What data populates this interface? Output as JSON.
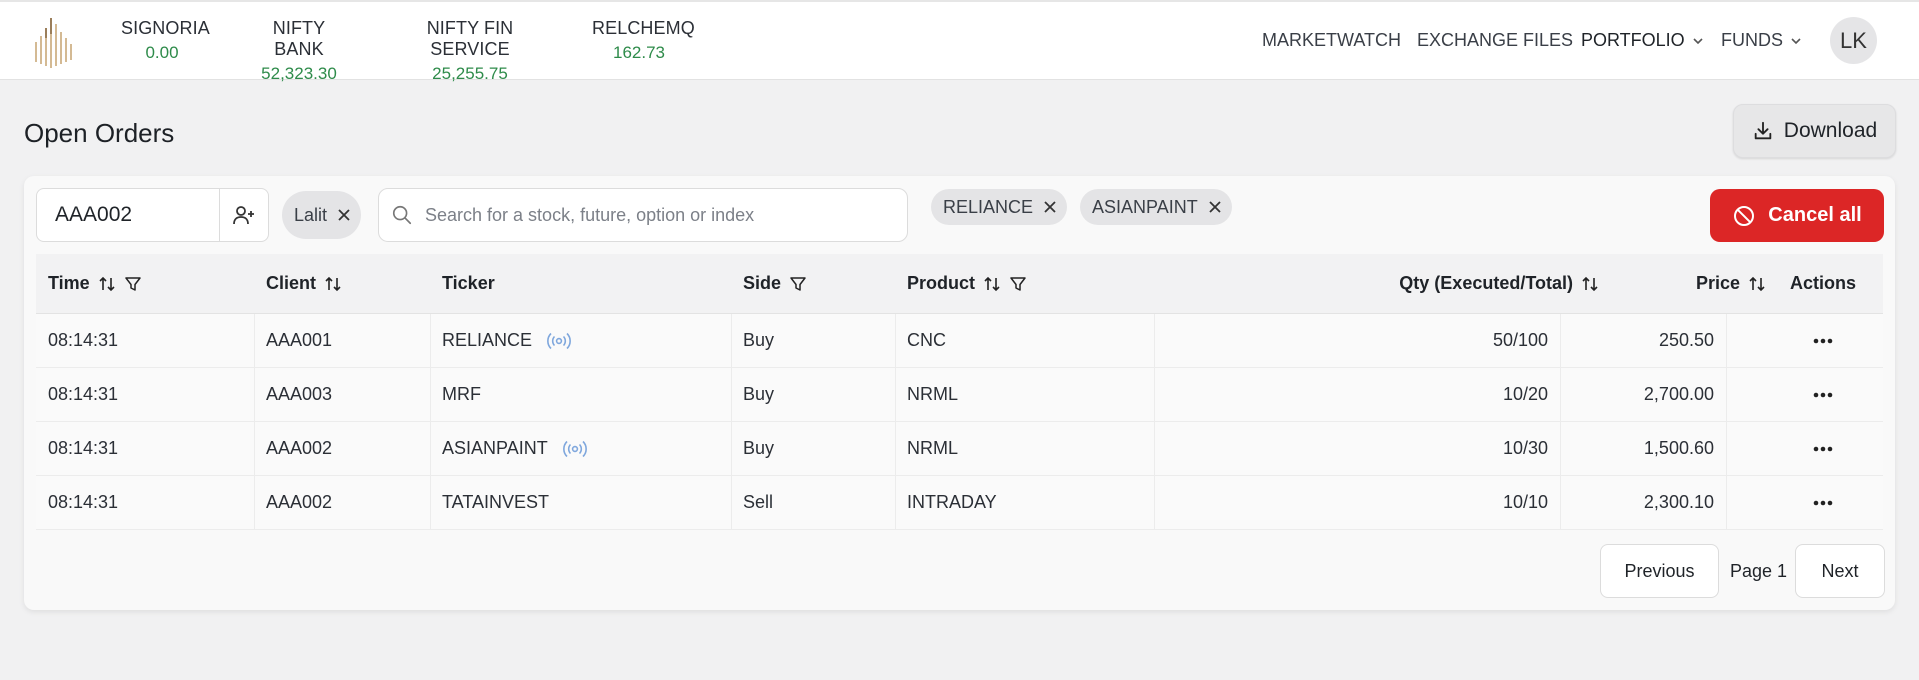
{
  "header": {
    "tickers": [
      {
        "name": "SIGNORIA",
        "value": "0.00"
      },
      {
        "name": "NIFTY BANK",
        "value": "52,323.30"
      },
      {
        "name": "NIFTY FIN SERVICE",
        "value": "25,255.75"
      },
      {
        "name": "RELCHEMQ",
        "value": "162.73"
      }
    ],
    "nav": {
      "marketwatch": "MARKETWATCH",
      "exchange_files": "EXCHANGE FILES",
      "portfolio": "PORTFOLIO",
      "funds": "FUNDS"
    },
    "avatar_initials": "LK"
  },
  "page": {
    "title": "Open Orders",
    "download_label": "Download"
  },
  "filters": {
    "client_value": "AAA002",
    "user_chip": "Lalit",
    "search_placeholder": "Search for a stock, future, option or index",
    "ticker_chips": [
      "RELIANCE",
      "ASIANPAINT"
    ],
    "cancel_all_label": "Cancel all"
  },
  "table": {
    "columns": {
      "time": "Time",
      "client": "Client",
      "ticker": "Ticker",
      "side": "Side",
      "product": "Product",
      "qty": "Qty (Executed/Total)",
      "price": "Price",
      "actions": "Actions"
    },
    "rows": [
      {
        "time": "08:14:31",
        "client": "AAA001",
        "ticker": "RELIANCE",
        "live": true,
        "side": "Buy",
        "product": "CNC",
        "qty": "50/100",
        "price": "250.50"
      },
      {
        "time": "08:14:31",
        "client": "AAA003",
        "ticker": "MRF",
        "live": false,
        "side": "Buy",
        "product": "NRML",
        "qty": "10/20",
        "price": "2,700.00"
      },
      {
        "time": "08:14:31",
        "client": "AAA002",
        "ticker": "ASIANPAINT",
        "live": true,
        "side": "Buy",
        "product": "NRML",
        "qty": "10/30",
        "price": "1,500.60"
      },
      {
        "time": "08:14:31",
        "client": "AAA002",
        "ticker": "TATAINVEST",
        "live": false,
        "side": "Sell",
        "product": "INTRADAY",
        "qty": "10/10",
        "price": "2,300.10"
      }
    ]
  },
  "pagination": {
    "previous": "Previous",
    "page_label": "Page 1",
    "next": "Next"
  },
  "colors": {
    "positive": "#2e8b4a",
    "danger": "#dc2626",
    "live_icon": "#7fa7dd"
  }
}
